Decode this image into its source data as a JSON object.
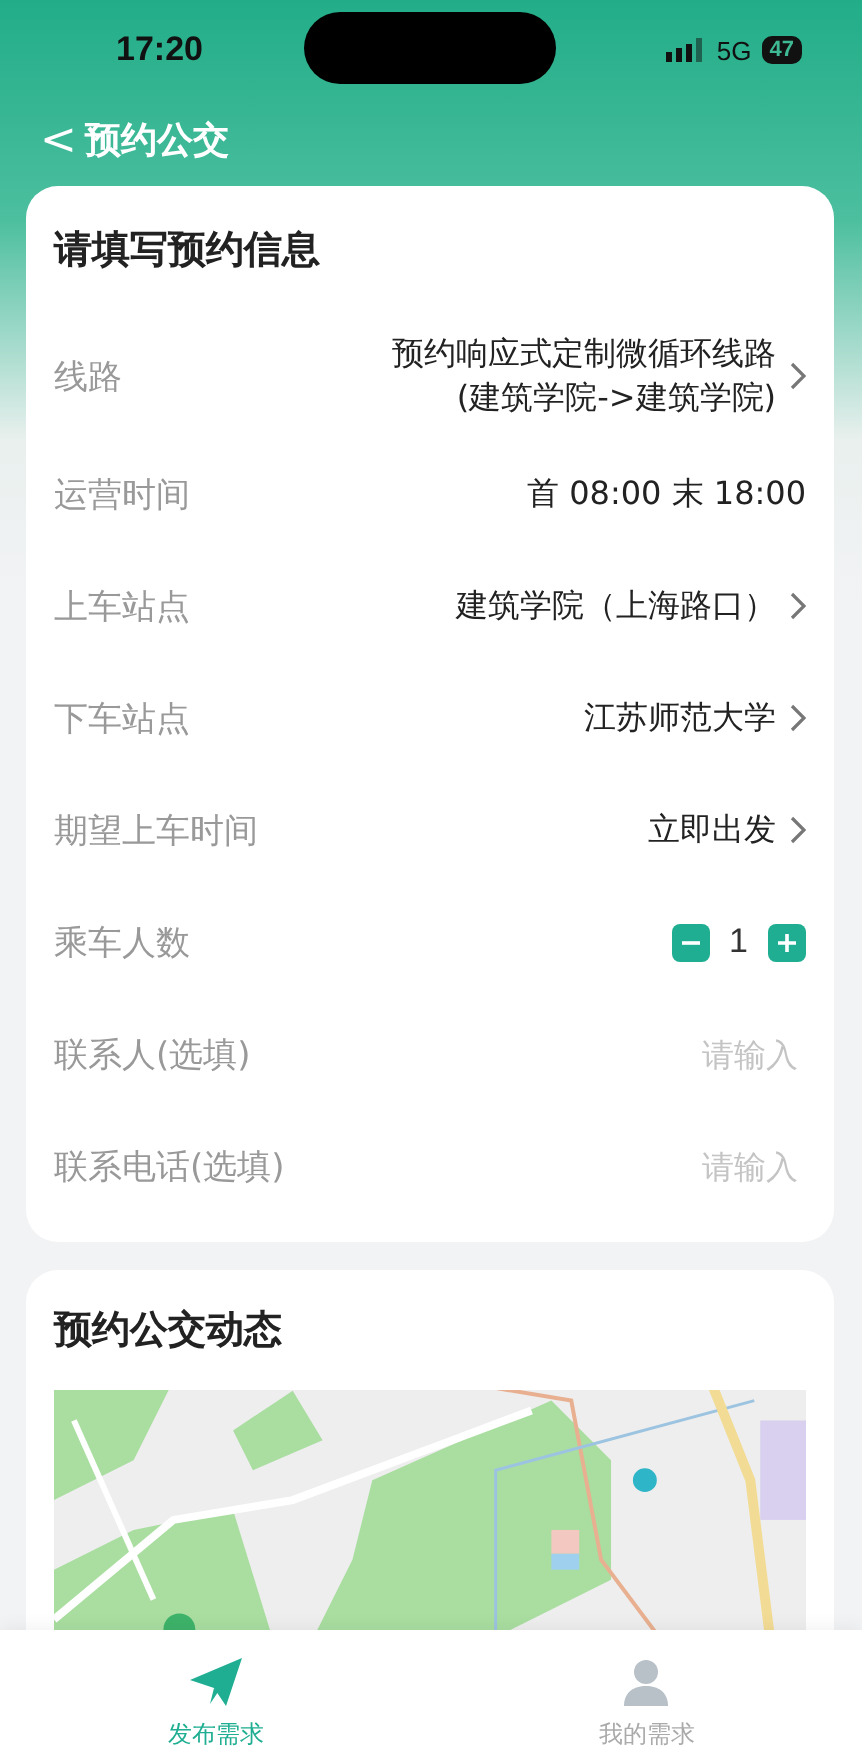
{
  "status_bar": {
    "time": "17:20",
    "network": "5G",
    "battery": "47"
  },
  "header": {
    "back": "<",
    "title": "预约公交"
  },
  "form": {
    "title": "请填写预约信息",
    "rows": [
      {
        "kind": "select",
        "label": "线路",
        "lines": [
          "预约响应式定制微循环线路",
          "(建筑学院->建筑学院)"
        ]
      },
      {
        "kind": "text",
        "label": "运营时间",
        "lines": [
          "首 08:00 末 18:00"
        ]
      },
      {
        "kind": "select",
        "label": "上车站点",
        "lines": [
          "建筑学院（上海路口）"
        ]
      },
      {
        "kind": "select",
        "label": "下车站点",
        "lines": [
          "江苏师范大学"
        ]
      },
      {
        "kind": "select",
        "label": "期望上车时间",
        "lines": [
          "立即出发"
        ]
      },
      {
        "kind": "stepper",
        "label": "乘车人数",
        "value": "1"
      },
      {
        "kind": "input",
        "label": "联系人(选填)",
        "placeholder": "请输入"
      },
      {
        "kind": "input",
        "label": "联系电话(选填)",
        "placeholder": "请输入"
      }
    ]
  },
  "dynamics": {
    "title": "预约公交动态"
  },
  "tabs": [
    {
      "label": "发布需求",
      "selected": true
    },
    {
      "label": "我的需求",
      "selected": false
    }
  ]
}
